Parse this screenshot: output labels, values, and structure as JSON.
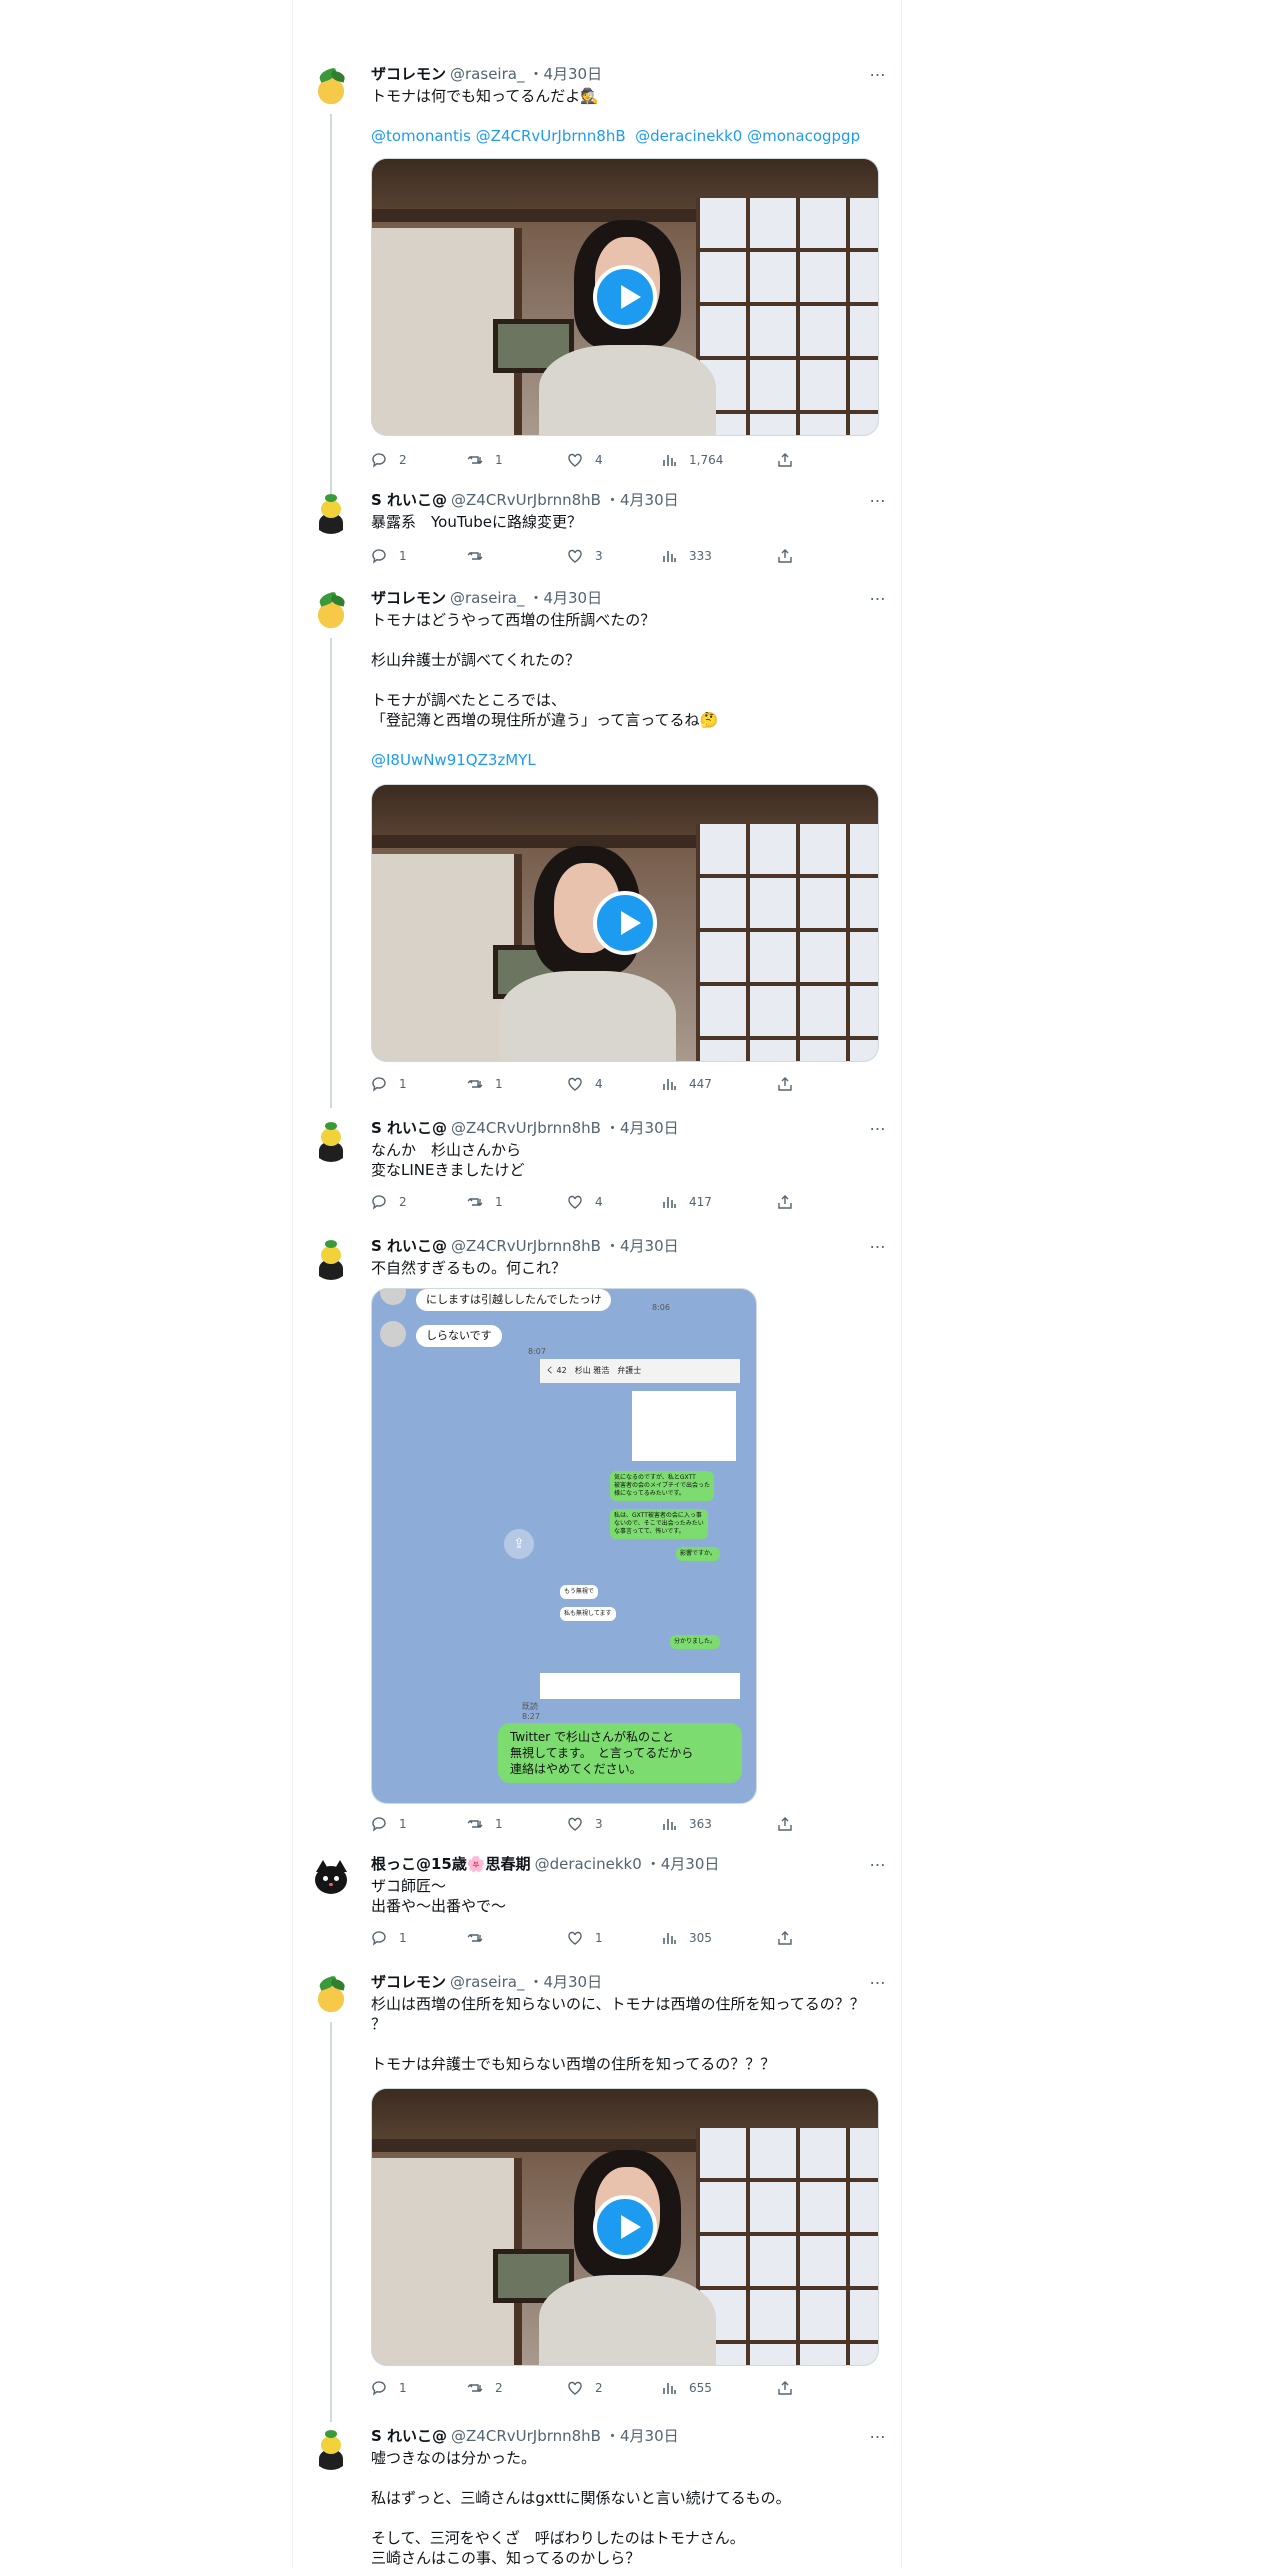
{
  "tweets": [
    {
      "name": "ザコレモン",
      "handle": "@raseira_",
      "date": "・4月30日",
      "text": "トモナは何でも知ってるんだよ🕵️",
      "links": "@tomonantis @Z4CRvUrJbrnn8hB  @deracinekk0 @monacogpgp",
      "media": "video",
      "replies": "2",
      "retweets": "1",
      "likes": "4",
      "views": "1,764"
    },
    {
      "name": "S れいこ@",
      "handle": "@Z4CRvUrJbrnn8hB",
      "date": "・4月30日",
      "text": "暴露系　YouTubeに路線変更？",
      "replies": "1",
      "retweets": "",
      "likes": "3",
      "views": "333"
    },
    {
      "name": "ザコレモン",
      "handle": "@raseira_",
      "date": "・4月30日",
      "text": "トモナはどうやって西増の住所調べたの？\n\n杉山弁護士が調べてくれたの？\n\nトモナが調べたところでは、\n「登記簿と西増の現住所が違う」って言ってるね🤔",
      "links": "@I8UwNw91QZ3zMYL",
      "media": "video",
      "replies": "1",
      "retweets": "1",
      "likes": "4",
      "views": "447"
    },
    {
      "name": "S れいこ@",
      "handle": "@Z4CRvUrJbrnn8hB",
      "date": "・4月30日",
      "text": "なんか　杉山さんから\n変なLINEきましたけど",
      "replies": "2",
      "retweets": "1",
      "likes": "4",
      "views": "417"
    },
    {
      "name": "S れいこ@",
      "handle": "@Z4CRvUrJbrnn8hB",
      "date": "・4月30日",
      "text": "不自然すぎるもの。何これ？",
      "media": "chat",
      "chat": {
        "bubble1": "にしますは引越ししたんでしたっけ",
        "time1": "8:06",
        "bubble2": "しらないです",
        "time2": "8:07",
        "inner_header": "く 42　杉山 雅浩　弁護士",
        "inner1": "気になるのですが、私とGXTT\n被害者の会のメイブチイで出会った\n様になってるみたいです。",
        "inner2": "私は、GXTT被害者の会に入っ事\nないので、そこで出会ったみたい\nな事言ってて、怖いです。",
        "inner3": "影響ですか。",
        "inner4": "もう無視で",
        "inner5": "私も無視してます",
        "inner6": "分かりました。",
        "bottom_bubble": "Twitter で杉山さんが私のこと\n無視してます。　と言ってるだから\n連絡はやめてください。",
        "bottom_time": "既読\n8:27"
      },
      "replies": "1",
      "retweets": "1",
      "likes": "3",
      "views": "363"
    },
    {
      "name": "根っこ@15歳🌸思春期",
      "handle": "@deracinekk0",
      "date": "・4月30日",
      "text": "ザコ師匠〜\n出番や～出番やで～",
      "replies": "1",
      "retweets": "",
      "likes": "1",
      "views": "305"
    },
    {
      "name": "ザコレモン",
      "handle": "@raseira_",
      "date": "・4月30日",
      "text": "杉山は西増の住所を知らないのに、トモナは西増の住所を知ってるの？？\n？\n\nトモナは弁護士でも知らない西増の住所を知ってるの？？？",
      "media": "video",
      "replies": "1",
      "retweets": "2",
      "likes": "2",
      "views": "655"
    },
    {
      "name": "S れいこ@",
      "handle": "@Z4CRvUrJbrnn8hB",
      "date": "・4月30日",
      "text": "嘘つきなのは分かった。\n\n私はずっと、三崎さんはgxttに関係ないと言い続けてるもの。\n\nそして、三河をやくざ　呼ばわりしたのはトモナさん。\n三崎さんはこの事、知ってるのかしら？",
      "replies": "",
      "retweets": "",
      "likes": "",
      "views": ""
    }
  ],
  "more_icon": "…"
}
